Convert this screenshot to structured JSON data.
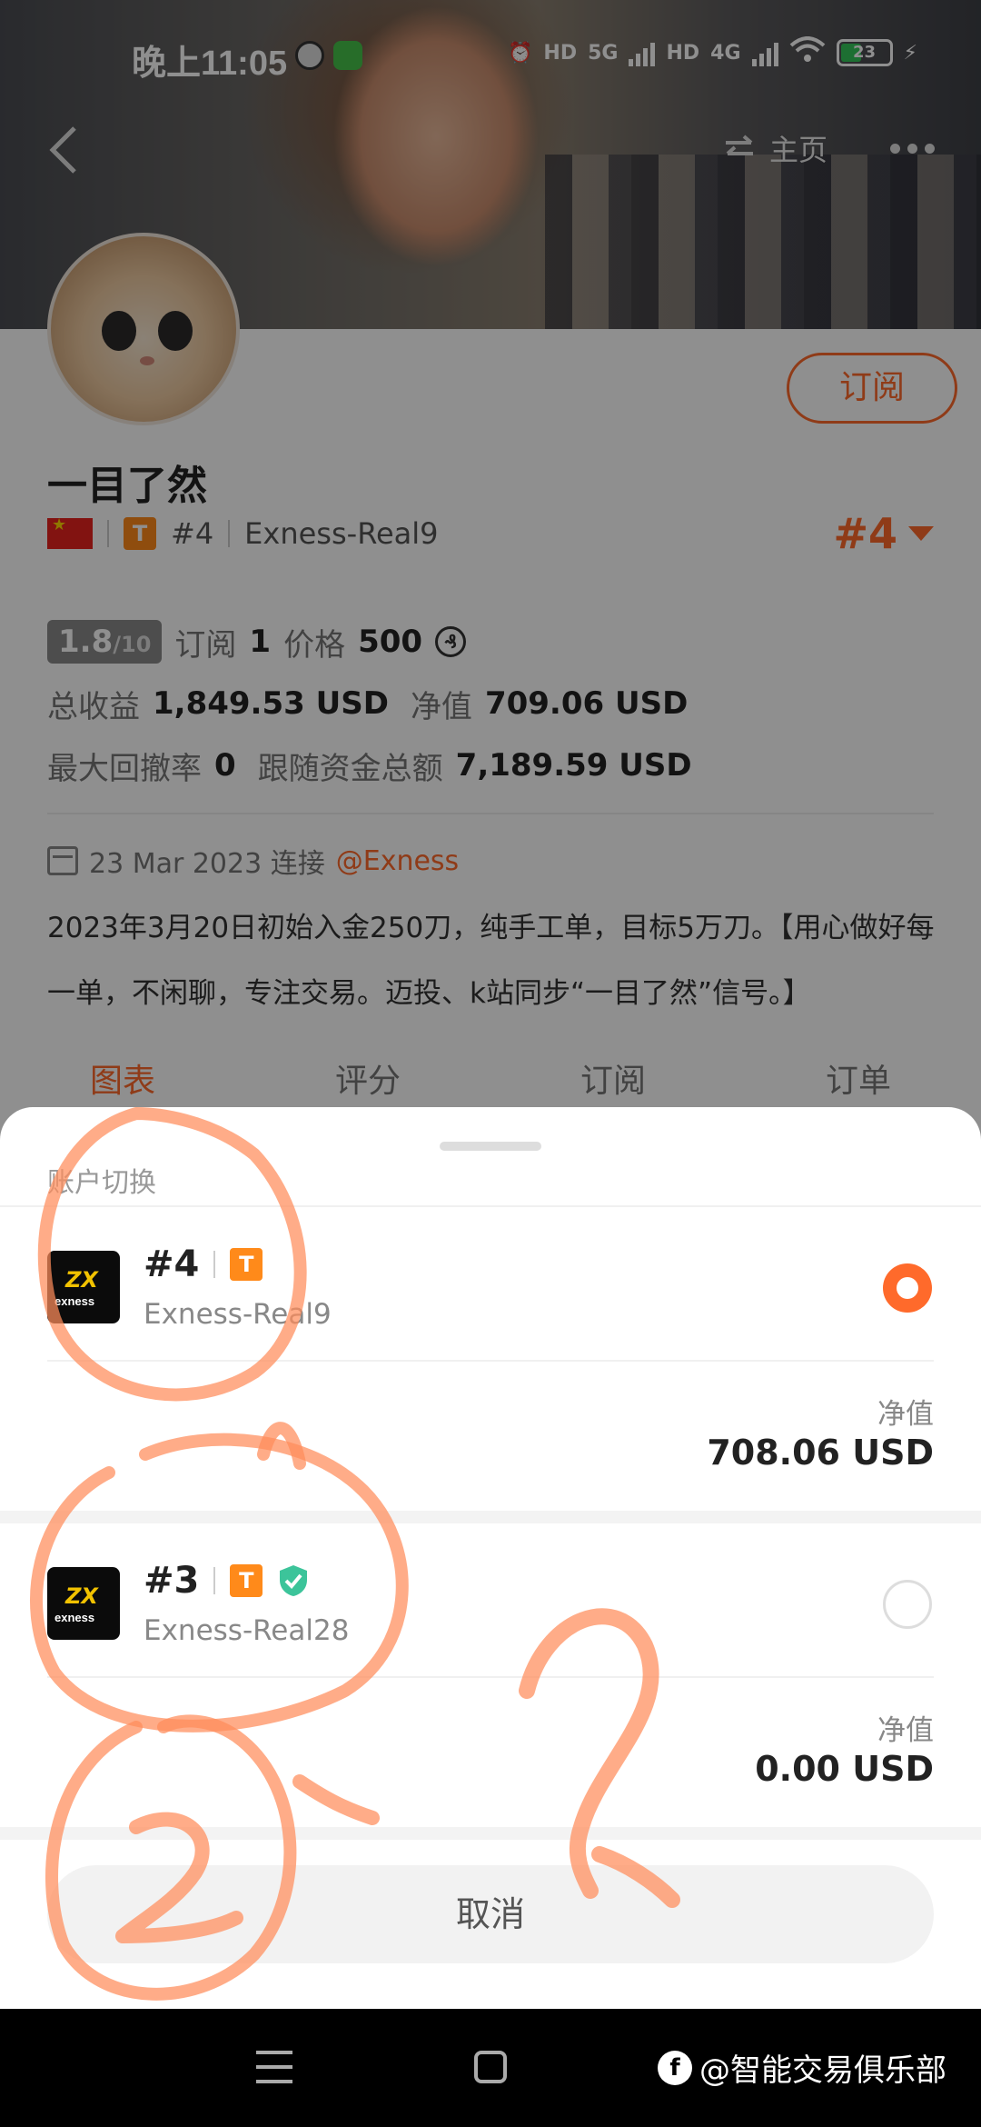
{
  "status_bar": {
    "time": "晚上11:05",
    "net_5g": "5G",
    "net_4g": "4G",
    "hd": "HD",
    "battery": "23"
  },
  "header": {
    "home_label": "主页",
    "back_icon": "chevron-left-icon",
    "more_icon": "more-dots-icon"
  },
  "profile": {
    "name": "一目了然",
    "rank": "#4",
    "server": "Exness-Real9",
    "rank_selector": "#4",
    "subscribe_label": "订阅",
    "score": "1.8",
    "score_max": "/10",
    "subscribe_count_label": "订阅",
    "subscribe_count": "1",
    "price_label": "价格",
    "price": "500",
    "coin_symbol": "₰",
    "total_profit_label": "总收益",
    "total_profit": "1,849.53 USD",
    "net_value_label": "净值",
    "net_value": "709.06 USD",
    "max_drawdown_label": "最大回撤率",
    "max_drawdown": "0",
    "follow_total_label": "跟随资金总额",
    "follow_total": "7,189.59 USD",
    "connect_date": "23 Mar 2023 连接",
    "connect_link": "@Exness",
    "bio": "2023年3月20日初始入金250刀，纯手工单，目标5万刀。【用心做好每一单，不闲聊，专注交易。迈投、k站同步“一目了然”信号。】"
  },
  "tabs": [
    {
      "label": "图表",
      "active": true
    },
    {
      "label": "评分",
      "active": false
    },
    {
      "label": "订阅",
      "active": false
    },
    {
      "label": "订单",
      "active": false
    }
  ],
  "sheet": {
    "title": "账户切换",
    "accounts": [
      {
        "rank": "#4",
        "server": "Exness-Real9",
        "net_label": "净值",
        "net_value": "708.06 USD",
        "selected": true,
        "verified": false
      },
      {
        "rank": "#3",
        "server": "Exness-Real28",
        "net_label": "净值",
        "net_value": "0.00 USD",
        "selected": false,
        "verified": true
      }
    ],
    "cancel_label": "取消",
    "logo_text_top": "ZX",
    "logo_text_bottom": "exness"
  },
  "tier_letter": "T",
  "watermark": "@智能交易俱乐部",
  "accent_color": "#ff6a2b"
}
